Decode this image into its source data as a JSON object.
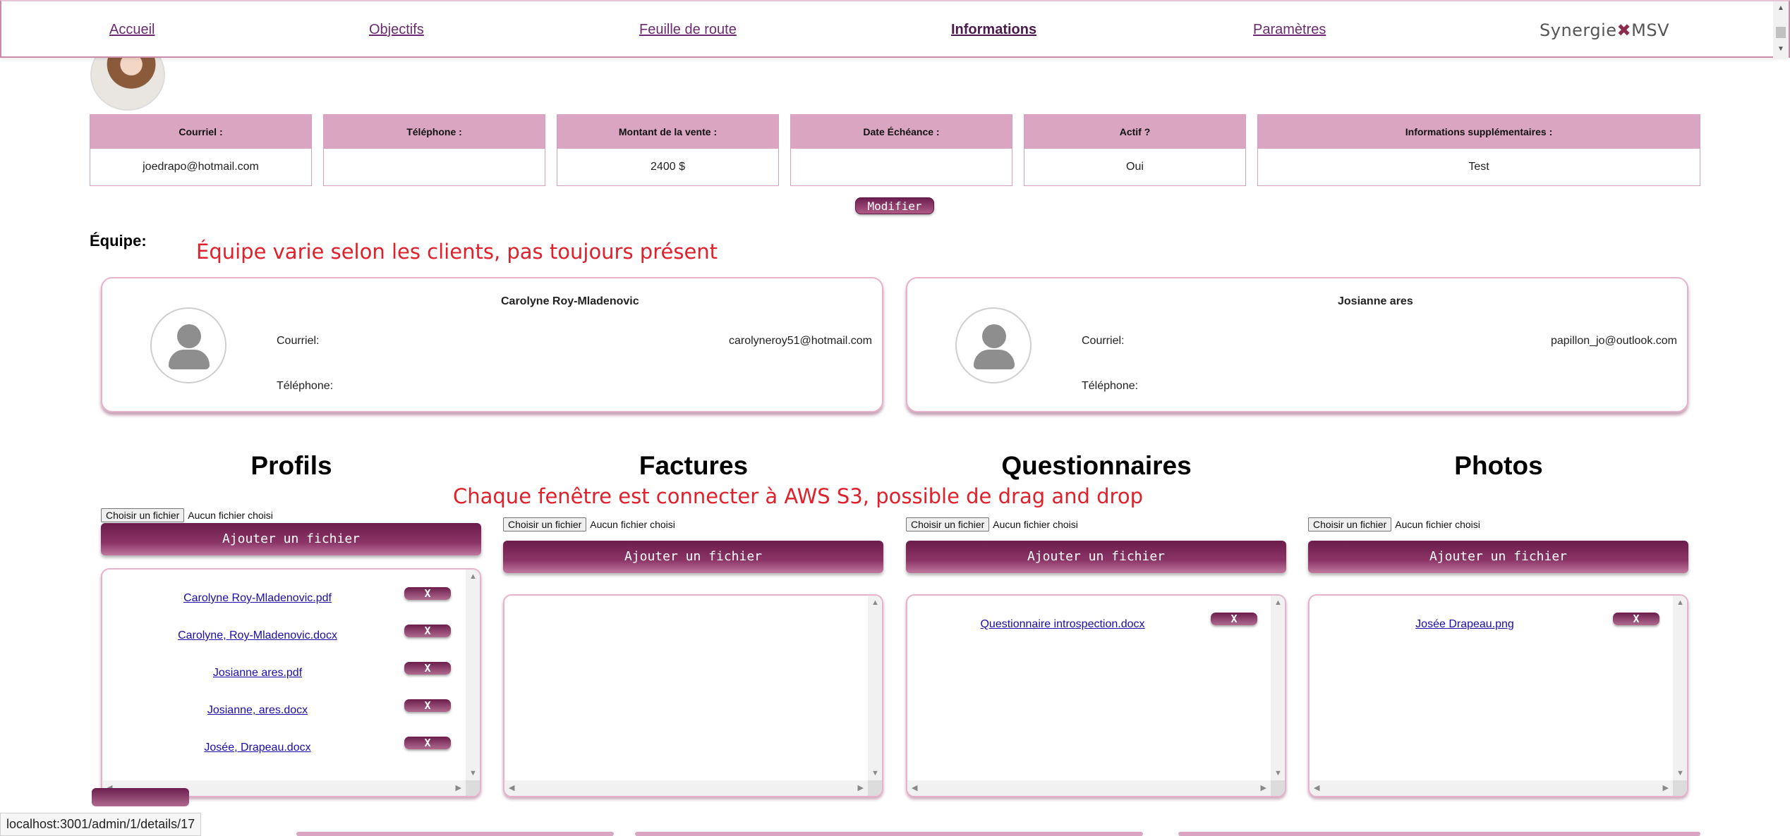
{
  "nav": {
    "items": [
      "Accueil",
      "Objectifs",
      "Feuille de route",
      "Informations",
      "Paramètres"
    ],
    "logo": "SynergieMSV",
    "logo_left": "Synergie",
    "logo_mark": "✖",
    "logo_right": "MSV"
  },
  "info": {
    "headers": [
      "Courriel :",
      "Téléphone :",
      "Montant de la vente :",
      "Date Échéance :",
      "Actif ?",
      "Informations supplémentaires :"
    ],
    "values": [
      "joedrapo@hotmail.com",
      "",
      "2400 $",
      "",
      "Oui",
      "Test"
    ],
    "modify_label": "Modifier"
  },
  "team": {
    "label": "Équipe:",
    "note": "Équipe varie selon les clients, pas toujours présent",
    "members": [
      {
        "name": "Carolyne Roy-Mladenovic",
        "email_label": "Courriel:",
        "email": "carolyneroy51@hotmail.com",
        "phone_label": "Téléphone:"
      },
      {
        "name": "Josianne ares",
        "email_label": "Courriel:",
        "email": "papillon_jo@outlook.com",
        "phone_label": "Téléphone:"
      }
    ]
  },
  "files_note": "Chaque fenêtre est connecter à AWS S3, possible de drag and drop",
  "sections": [
    {
      "title": "Profils",
      "choose": "Choisir un fichier",
      "none": "Aucun fichier choisi",
      "add": "Ajouter un fichier",
      "files": [
        "Carolyne Roy-Mladenovic.pdf",
        "Carolyne, Roy-Mladenovic.docx",
        "Josianne ares.pdf",
        "Josianne, ares.docx",
        "Josée, Drapeau.docx"
      ]
    },
    {
      "title": "Factures",
      "choose": "Choisir un fichier",
      "none": "Aucun fichier choisi",
      "add": "Ajouter un fichier",
      "files": []
    },
    {
      "title": "Questionnaires",
      "choose": "Choisir un fichier",
      "none": "Aucun fichier choisi",
      "add": "Ajouter un fichier",
      "files": [
        "Questionnaire introspection.docx"
      ]
    },
    {
      "title": "Photos",
      "choose": "Choisir un fichier",
      "none": "Aucun fichier choisi",
      "add": "Ajouter un fichier",
      "files": [
        "Josée Drapeau.png"
      ]
    }
  ],
  "delete_label": "X",
  "status_url": "localhost:3001/admin/1/details/17",
  "colors": {
    "accent": "#7a2455",
    "header_pink": "#d9a5c0",
    "note_red": "#e0202a"
  }
}
